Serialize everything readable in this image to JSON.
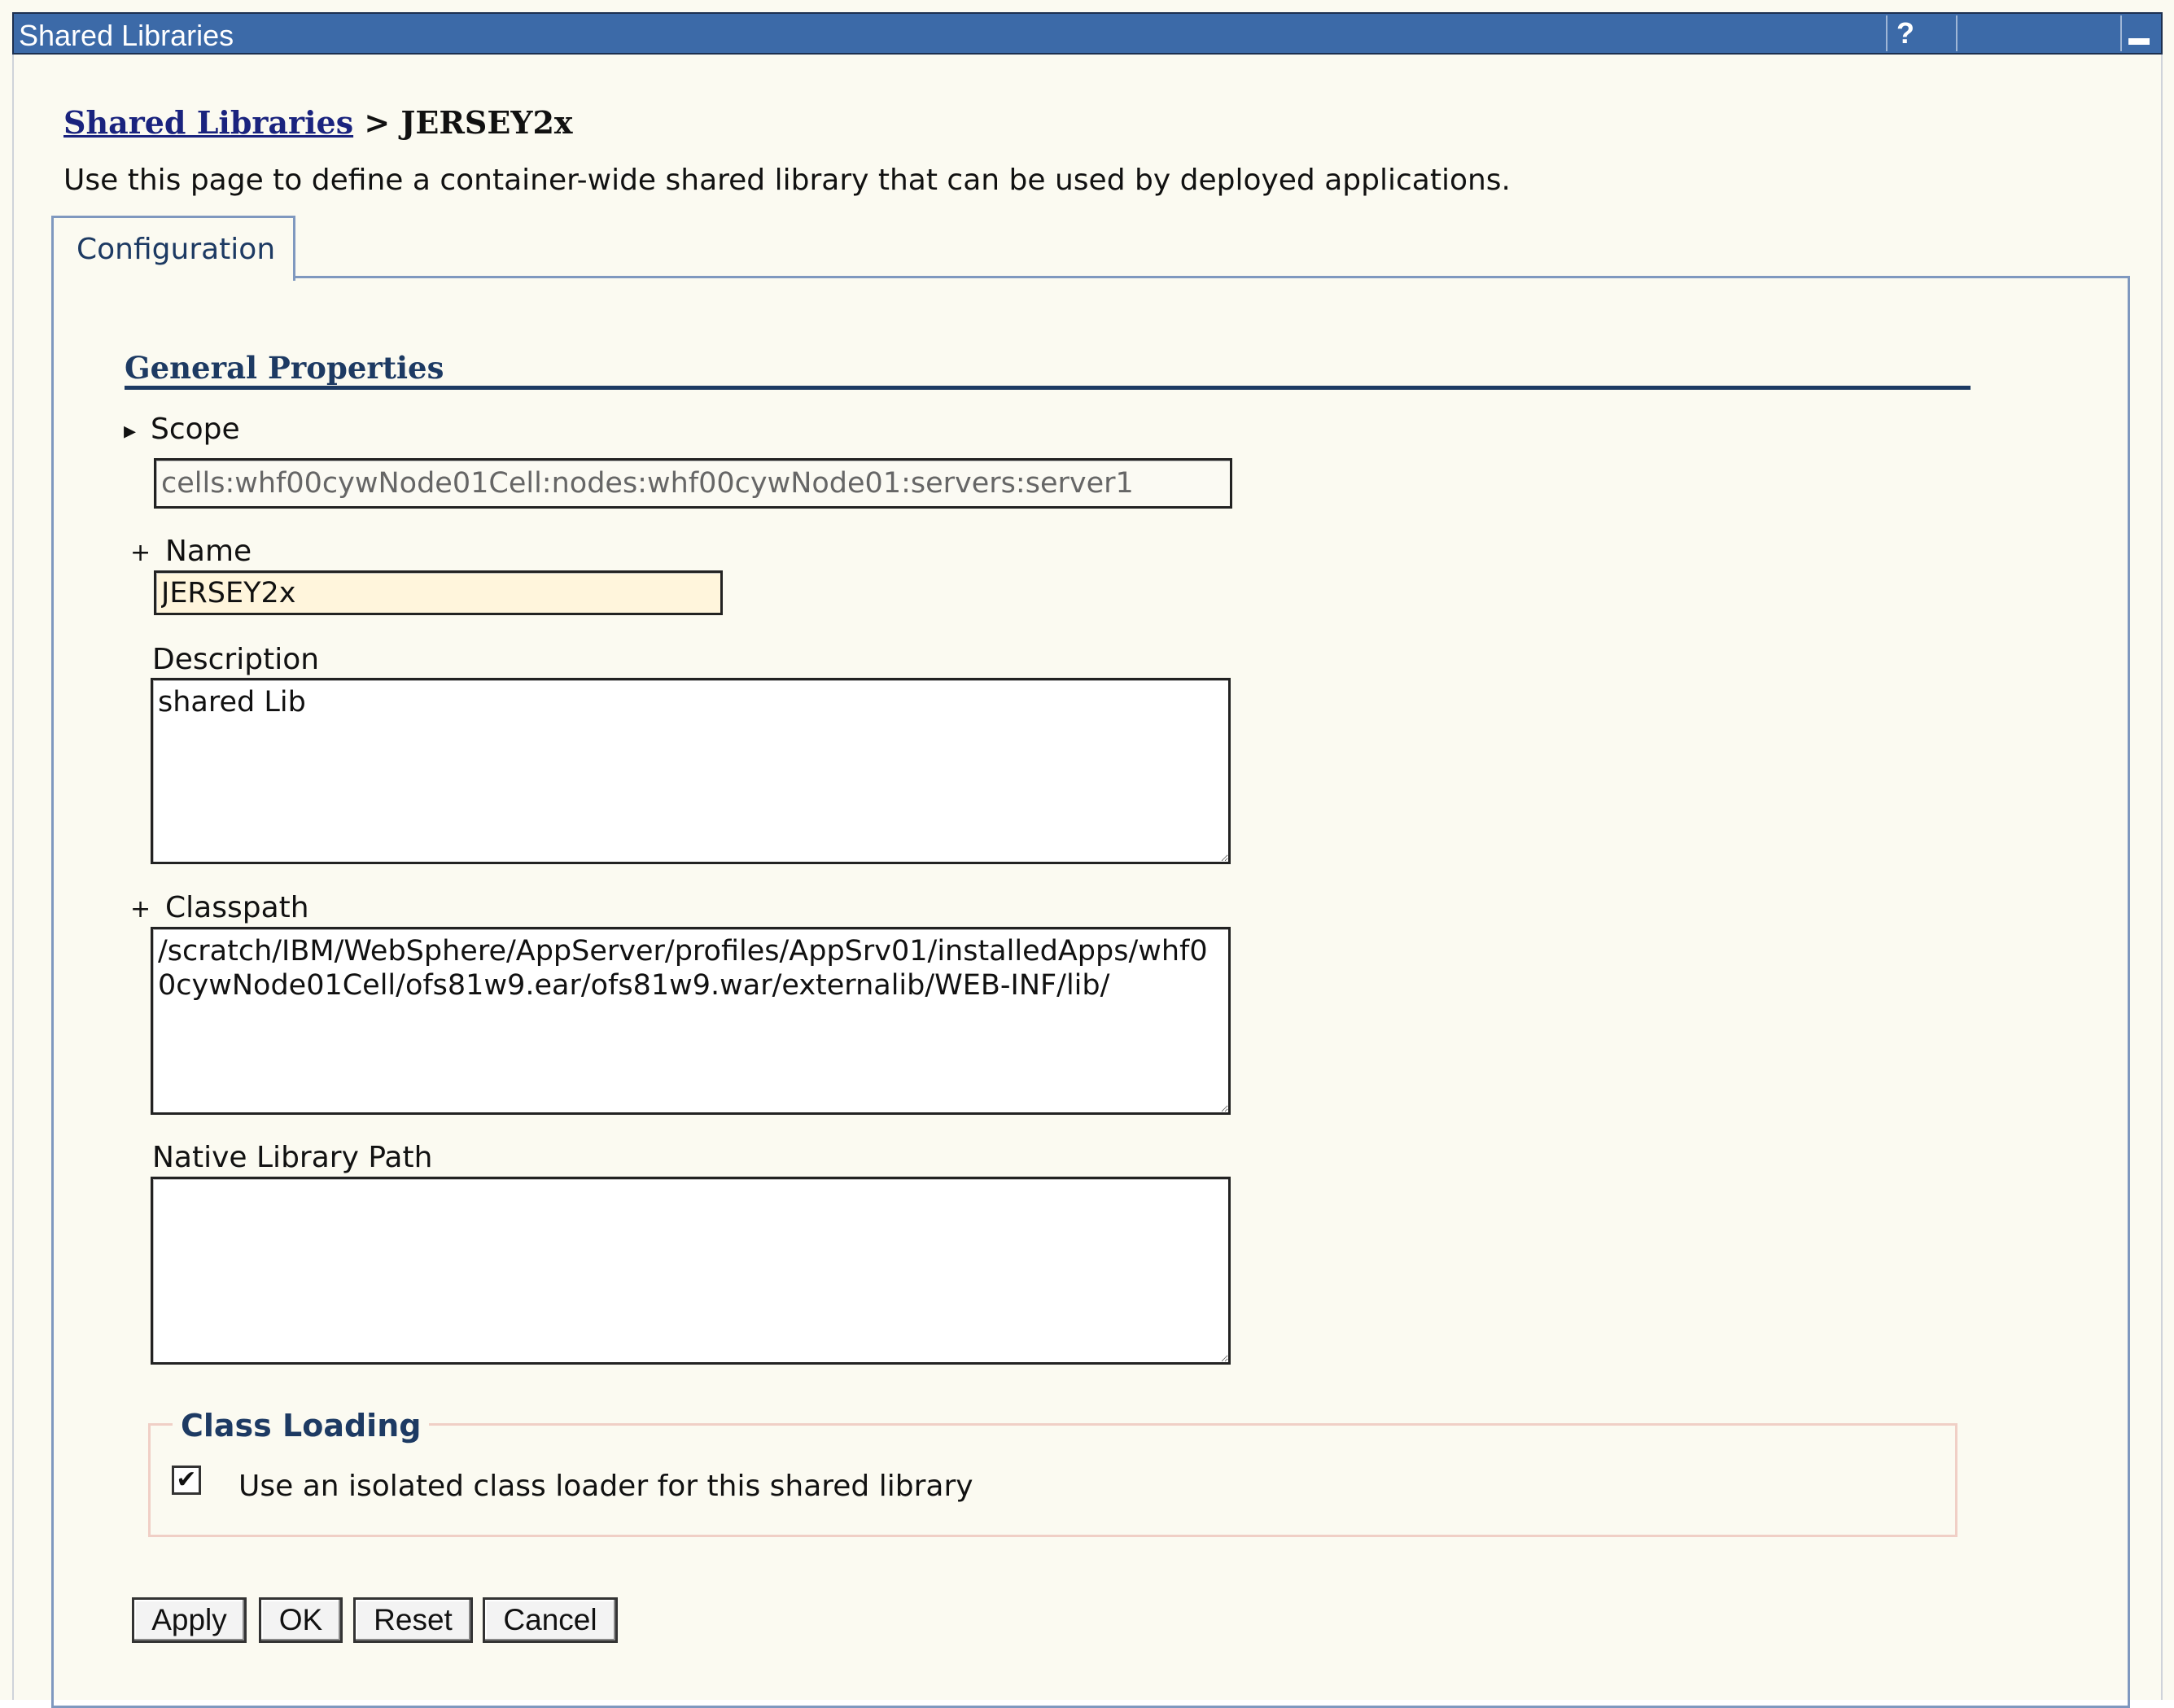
{
  "window": {
    "title": "Shared Libraries",
    "help_glyph": "?"
  },
  "breadcrumb": {
    "parent": "Shared Libraries",
    "separator": ">",
    "current": "JERSEY2x"
  },
  "intro": "Use this page to define a container-wide shared library that can be used by deployed applications.",
  "tabs": [
    {
      "label": "Configuration",
      "active": true
    }
  ],
  "general": {
    "title": "General Properties",
    "scope": {
      "label": "Scope",
      "value": "cells:whf00cywNode01Cell:nodes:whf00cywNode01:servers:server1"
    },
    "name": {
      "label": "Name",
      "value": "JERSEY2x",
      "required_marker": "+"
    },
    "description": {
      "label": "Description",
      "value": "shared Lib"
    },
    "classpath": {
      "label": "Classpath",
      "value": "/scratch/IBM/WebSphere/AppServer/profiles/AppSrv01/installedApps/whf00cywNode01Cell/ofs81w9.ear/ofs81w9.war/externalib/WEB-INF/lib/",
      "required_marker": "+"
    },
    "native_path": {
      "label": "Native Library Path",
      "value": ""
    }
  },
  "class_loading": {
    "title": "Class Loading",
    "isolated_label": "Use an isolated class loader for this shared library",
    "isolated_checked": true,
    "check_glyph": "✔"
  },
  "buttons": {
    "apply": "Apply",
    "ok": "OK",
    "reset": "Reset",
    "cancel": "Cancel"
  },
  "colors": {
    "titlebar": "#3c6aa8",
    "accent": "#1d3a63",
    "link": "#1a237e",
    "required_field": "#fff5dc",
    "background": "#fbfaf1"
  }
}
